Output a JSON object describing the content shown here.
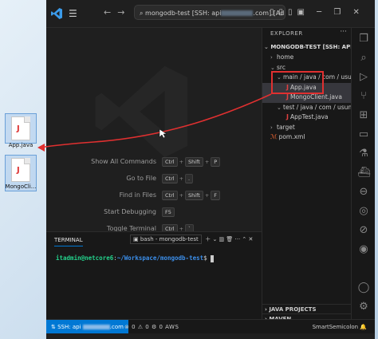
{
  "desktop": {
    "files": [
      {
        "label": "App.java"
      },
      {
        "label": "MongoCli..."
      }
    ]
  },
  "titlebar": {
    "command_center_text": "mongodb-test [SSH: api",
    "command_center_suffix": ".com] [Adm..."
  },
  "welcome": {
    "shortcuts": [
      {
        "label": "Show All Commands",
        "keys": [
          "Ctrl",
          "Shift",
          "P"
        ]
      },
      {
        "label": "Go to File",
        "keys": [
          "Ctrl",
          "."
        ]
      },
      {
        "label": "Find in Files",
        "keys": [
          "Ctrl",
          "Shift",
          "F"
        ]
      },
      {
        "label": "Start Debugging",
        "keys": [
          "F5"
        ]
      },
      {
        "label": "Toggle Terminal",
        "keys": [
          "Ctrl",
          "`"
        ]
      }
    ]
  },
  "explorer": {
    "title": "EXPLORER",
    "root": "MONGODB-TEST [SSH: API-TEST.U...",
    "items": [
      {
        "label": "home"
      },
      {
        "label": "src"
      },
      {
        "label": "main / java / com / usuntek"
      },
      {
        "label": "App.java"
      },
      {
        "label": "MongoClient.java"
      },
      {
        "label": "test / java / com / usuntek"
      },
      {
        "label": "AppTest.java"
      },
      {
        "label": "target"
      },
      {
        "label": "pom.xml"
      }
    ],
    "sections": [
      "JAVA PROJECTS",
      "MAVEN"
    ]
  },
  "panel": {
    "tab": "TERMINAL",
    "shell": "bash - mongodb-test",
    "prompt_user": "itadmin@netcore6",
    "prompt_path": "~/Workspace/mongodb-test",
    "prompt_symbol": "$"
  },
  "statusbar": {
    "remote": "SSH: api",
    "remote_suffix": ".com",
    "counts": "⊗ 0  ⚠ 0   ⚙ 0   AWS",
    "right": "SmartSemicolon"
  }
}
